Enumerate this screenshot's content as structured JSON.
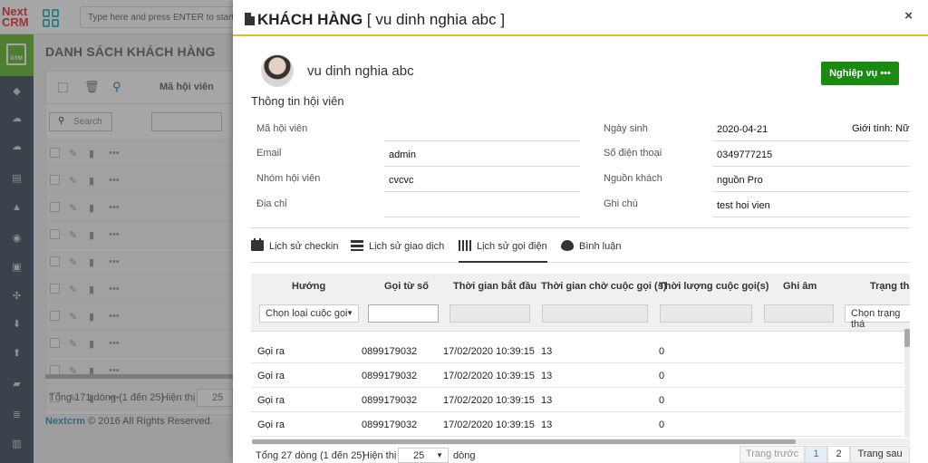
{
  "logo": {
    "line1": "Next",
    "line2": "CRM"
  },
  "search_top": {
    "placeholder": "Type here and press ENTER to start yo"
  },
  "sidebar": {
    "gym_label": "GYM"
  },
  "background_list": {
    "title": "DANH SÁCH",
    "subtitle": "KHÁCH HÀNG",
    "column": "Mã hội viên",
    "search_placeholder": "Search",
    "footer_total": "Tổng 171 dòng (1 đến 25)",
    "footer_show": "Hiện thị",
    "footer_page_size": "25",
    "copyright_brand": "Nextcrm",
    "copyright_text": "© 2016 All Rights Reserved."
  },
  "modal": {
    "title_bold": "KHÁCH HÀNG",
    "title_rest": "[ vu dinh nghia abc ]",
    "close_label": "×",
    "customer_name": "vu dinh nghia abc",
    "action_button": "Nghiệp vụ •••",
    "section_title": "Thông tin hội viên",
    "fields": {
      "member_code_label": "Mã hội viên",
      "member_code_value": "",
      "email_label": "Email",
      "email_value": "admin",
      "group_label": "Nhóm hội viên",
      "group_value": "cvcvc",
      "address_label": "Địa chỉ",
      "address_value": "",
      "birthday_label": "Ngày sinh",
      "birthday_value": "2020-04-21",
      "gender_text": "Giới tính: Nữ",
      "phone_label": "Số điện thoại",
      "phone_value": "0349777215",
      "source_label": "Nguồn khách",
      "source_value": "nguồn Pro",
      "note_label": "Ghi chú",
      "note_value": "test hoi vien"
    },
    "tabs": [
      "Lịch sử checkin",
      "Lịch sử giao dịch",
      "Lịch sử gọi điện",
      "Bình luận"
    ],
    "active_tab": "Lịch sử gọi điện",
    "table": {
      "columns": [
        "Hướng",
        "Gọi từ số",
        "Thời gian bắt đầu",
        "Thời gian chờ cuộc gọi (s)",
        "Thời lượng cuộc gọi(s)",
        "Ghi âm",
        "Trạng thá"
      ],
      "filter_direction": "Chọn loại cuộc gọi",
      "filter_status": "Chọn trạng thá",
      "rows": [
        {
          "direction": "Gọi ra",
          "from": "0899179032",
          "start": "17/02/2020 10:39:15",
          "wait": "13",
          "duration": "0"
        },
        {
          "direction": "Gọi ra",
          "from": "0899179032",
          "start": "17/02/2020 10:39:15",
          "wait": "13",
          "duration": "0"
        },
        {
          "direction": "Gọi ra",
          "from": "0899179032",
          "start": "17/02/2020 10:39:15",
          "wait": "13",
          "duration": "0"
        },
        {
          "direction": "Gọi ra",
          "from": "0899179032",
          "start": "17/02/2020 10:39:15",
          "wait": "13",
          "duration": "0"
        }
      ]
    },
    "pagination": {
      "total": "Tổng 27 dòng (1 đến 25)",
      "show": "Hiện thị",
      "page_size": "25",
      "unit": "dòng",
      "prev": "Trang trước",
      "page1": "1",
      "page2": "2",
      "next": "Trang sau"
    }
  },
  "colors": {
    "accent_green": "#1a8a12",
    "header_rule": "#f0b429",
    "sidebar": "#5a6873",
    "gym_tile": "#7cc24c"
  }
}
